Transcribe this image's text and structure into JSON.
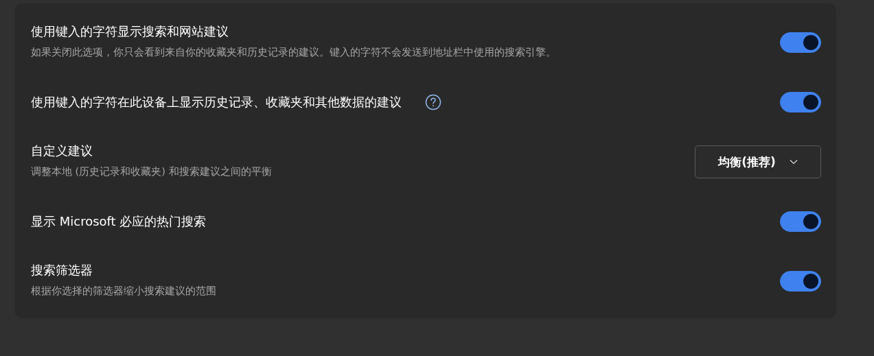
{
  "settings": [
    {
      "kind": "toggle",
      "title": "使用键入的字符显示搜索和网站建议",
      "description": "如果关闭此选项，你只会看到来自你的收藏夹和历史记录的建议。键入的字符不会发送到地址栏中使用的搜索引擎。",
      "on": true
    },
    {
      "kind": "toggle",
      "title": "使用键入的字符在此设备上显示历史记录、收藏夹和其他数据的建议",
      "help": true,
      "on": true
    },
    {
      "kind": "dropdown",
      "title": "自定义建议",
      "description": "调整本地 (历史记录和收藏夹) 和搜索建议之间的平衡",
      "value": "均衡(推荐)"
    },
    {
      "kind": "toggle",
      "title": "显示 Microsoft 必应的热门搜索",
      "on": true
    },
    {
      "kind": "toggle",
      "title": "搜索筛选器",
      "description": "根据你选择的筛选器缩小搜索建议的范围",
      "on": true
    }
  ]
}
